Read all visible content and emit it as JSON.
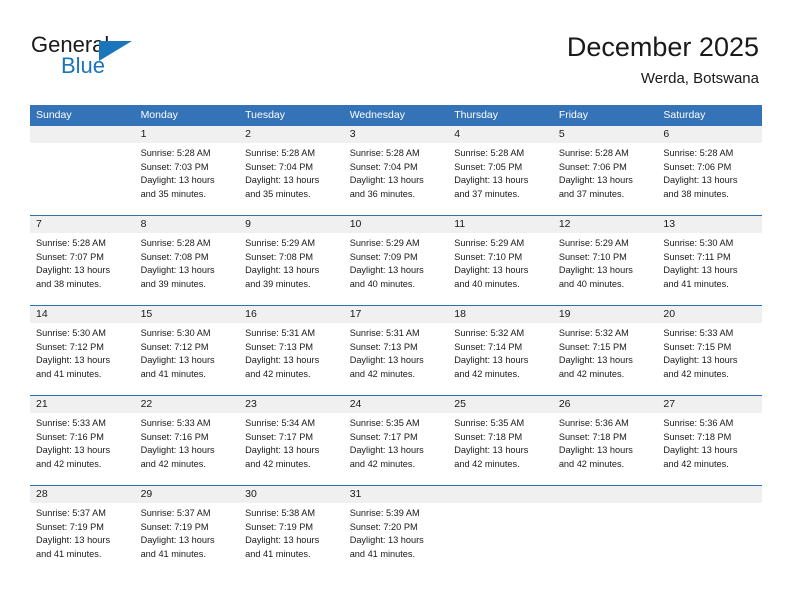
{
  "brand": {
    "word_general": "General",
    "word_blue": "Blue",
    "triangle_color": "#1b75bb"
  },
  "header": {
    "title": "December 2025",
    "location": "Werda, Botswana"
  },
  "theme": {
    "header_row_bg": "#3573b9",
    "daynum_band_bg": "#f0f0f0",
    "row_divider": "#2f6fad",
    "text": "#1a1a1a"
  },
  "weekday_headers": [
    "Sunday",
    "Monday",
    "Tuesday",
    "Wednesday",
    "Thursday",
    "Friday",
    "Saturday"
  ],
  "weeks": [
    [
      {
        "day": "",
        "blank": true,
        "sunrise": "",
        "sunset": "",
        "daylight_line1": "",
        "daylight_line2": ""
      },
      {
        "day": "1",
        "sunrise": "Sunrise: 5:28 AM",
        "sunset": "Sunset: 7:03 PM",
        "daylight_line1": "Daylight: 13 hours",
        "daylight_line2": "and 35 minutes."
      },
      {
        "day": "2",
        "sunrise": "Sunrise: 5:28 AM",
        "sunset": "Sunset: 7:04 PM",
        "daylight_line1": "Daylight: 13 hours",
        "daylight_line2": "and 35 minutes."
      },
      {
        "day": "3",
        "sunrise": "Sunrise: 5:28 AM",
        "sunset": "Sunset: 7:04 PM",
        "daylight_line1": "Daylight: 13 hours",
        "daylight_line2": "and 36 minutes."
      },
      {
        "day": "4",
        "sunrise": "Sunrise: 5:28 AM",
        "sunset": "Sunset: 7:05 PM",
        "daylight_line1": "Daylight: 13 hours",
        "daylight_line2": "and 37 minutes."
      },
      {
        "day": "5",
        "sunrise": "Sunrise: 5:28 AM",
        "sunset": "Sunset: 7:06 PM",
        "daylight_line1": "Daylight: 13 hours",
        "daylight_line2": "and 37 minutes."
      },
      {
        "day": "6",
        "sunrise": "Sunrise: 5:28 AM",
        "sunset": "Sunset: 7:06 PM",
        "daylight_line1": "Daylight: 13 hours",
        "daylight_line2": "and 38 minutes."
      }
    ],
    [
      {
        "day": "7",
        "sunrise": "Sunrise: 5:28 AM",
        "sunset": "Sunset: 7:07 PM",
        "daylight_line1": "Daylight: 13 hours",
        "daylight_line2": "and 38 minutes."
      },
      {
        "day": "8",
        "sunrise": "Sunrise: 5:28 AM",
        "sunset": "Sunset: 7:08 PM",
        "daylight_line1": "Daylight: 13 hours",
        "daylight_line2": "and 39 minutes."
      },
      {
        "day": "9",
        "sunrise": "Sunrise: 5:29 AM",
        "sunset": "Sunset: 7:08 PM",
        "daylight_line1": "Daylight: 13 hours",
        "daylight_line2": "and 39 minutes."
      },
      {
        "day": "10",
        "sunrise": "Sunrise: 5:29 AM",
        "sunset": "Sunset: 7:09 PM",
        "daylight_line1": "Daylight: 13 hours",
        "daylight_line2": "and 40 minutes."
      },
      {
        "day": "11",
        "sunrise": "Sunrise: 5:29 AM",
        "sunset": "Sunset: 7:10 PM",
        "daylight_line1": "Daylight: 13 hours",
        "daylight_line2": "and 40 minutes."
      },
      {
        "day": "12",
        "sunrise": "Sunrise: 5:29 AM",
        "sunset": "Sunset: 7:10 PM",
        "daylight_line1": "Daylight: 13 hours",
        "daylight_line2": "and 40 minutes."
      },
      {
        "day": "13",
        "sunrise": "Sunrise: 5:30 AM",
        "sunset": "Sunset: 7:11 PM",
        "daylight_line1": "Daylight: 13 hours",
        "daylight_line2": "and 41 minutes."
      }
    ],
    [
      {
        "day": "14",
        "sunrise": "Sunrise: 5:30 AM",
        "sunset": "Sunset: 7:12 PM",
        "daylight_line1": "Daylight: 13 hours",
        "daylight_line2": "and 41 minutes."
      },
      {
        "day": "15",
        "sunrise": "Sunrise: 5:30 AM",
        "sunset": "Sunset: 7:12 PM",
        "daylight_line1": "Daylight: 13 hours",
        "daylight_line2": "and 41 minutes."
      },
      {
        "day": "16",
        "sunrise": "Sunrise: 5:31 AM",
        "sunset": "Sunset: 7:13 PM",
        "daylight_line1": "Daylight: 13 hours",
        "daylight_line2": "and 42 minutes."
      },
      {
        "day": "17",
        "sunrise": "Sunrise: 5:31 AM",
        "sunset": "Sunset: 7:13 PM",
        "daylight_line1": "Daylight: 13 hours",
        "daylight_line2": "and 42 minutes."
      },
      {
        "day": "18",
        "sunrise": "Sunrise: 5:32 AM",
        "sunset": "Sunset: 7:14 PM",
        "daylight_line1": "Daylight: 13 hours",
        "daylight_line2": "and 42 minutes."
      },
      {
        "day": "19",
        "sunrise": "Sunrise: 5:32 AM",
        "sunset": "Sunset: 7:15 PM",
        "daylight_line1": "Daylight: 13 hours",
        "daylight_line2": "and 42 minutes."
      },
      {
        "day": "20",
        "sunrise": "Sunrise: 5:33 AM",
        "sunset": "Sunset: 7:15 PM",
        "daylight_line1": "Daylight: 13 hours",
        "daylight_line2": "and 42 minutes."
      }
    ],
    [
      {
        "day": "21",
        "sunrise": "Sunrise: 5:33 AM",
        "sunset": "Sunset: 7:16 PM",
        "daylight_line1": "Daylight: 13 hours",
        "daylight_line2": "and 42 minutes."
      },
      {
        "day": "22",
        "sunrise": "Sunrise: 5:33 AM",
        "sunset": "Sunset: 7:16 PM",
        "daylight_line1": "Daylight: 13 hours",
        "daylight_line2": "and 42 minutes."
      },
      {
        "day": "23",
        "sunrise": "Sunrise: 5:34 AM",
        "sunset": "Sunset: 7:17 PM",
        "daylight_line1": "Daylight: 13 hours",
        "daylight_line2": "and 42 minutes."
      },
      {
        "day": "24",
        "sunrise": "Sunrise: 5:35 AM",
        "sunset": "Sunset: 7:17 PM",
        "daylight_line1": "Daylight: 13 hours",
        "daylight_line2": "and 42 minutes."
      },
      {
        "day": "25",
        "sunrise": "Sunrise: 5:35 AM",
        "sunset": "Sunset: 7:18 PM",
        "daylight_line1": "Daylight: 13 hours",
        "daylight_line2": "and 42 minutes."
      },
      {
        "day": "26",
        "sunrise": "Sunrise: 5:36 AM",
        "sunset": "Sunset: 7:18 PM",
        "daylight_line1": "Daylight: 13 hours",
        "daylight_line2": "and 42 minutes."
      },
      {
        "day": "27",
        "sunrise": "Sunrise: 5:36 AM",
        "sunset": "Sunset: 7:18 PM",
        "daylight_line1": "Daylight: 13 hours",
        "daylight_line2": "and 42 minutes."
      }
    ],
    [
      {
        "day": "28",
        "sunrise": "Sunrise: 5:37 AM",
        "sunset": "Sunset: 7:19 PM",
        "daylight_line1": "Daylight: 13 hours",
        "daylight_line2": "and 41 minutes."
      },
      {
        "day": "29",
        "sunrise": "Sunrise: 5:37 AM",
        "sunset": "Sunset: 7:19 PM",
        "daylight_line1": "Daylight: 13 hours",
        "daylight_line2": "and 41 minutes."
      },
      {
        "day": "30",
        "sunrise": "Sunrise: 5:38 AM",
        "sunset": "Sunset: 7:19 PM",
        "daylight_line1": "Daylight: 13 hours",
        "daylight_line2": "and 41 minutes."
      },
      {
        "day": "31",
        "sunrise": "Sunrise: 5:39 AM",
        "sunset": "Sunset: 7:20 PM",
        "daylight_line1": "Daylight: 13 hours",
        "daylight_line2": "and 41 minutes."
      },
      {
        "day": "",
        "blank": true,
        "sunrise": "",
        "sunset": "",
        "daylight_line1": "",
        "daylight_line2": ""
      },
      {
        "day": "",
        "blank": true,
        "sunrise": "",
        "sunset": "",
        "daylight_line1": "",
        "daylight_line2": ""
      },
      {
        "day": "",
        "blank": true,
        "sunrise": "",
        "sunset": "",
        "daylight_line1": "",
        "daylight_line2": ""
      }
    ]
  ]
}
